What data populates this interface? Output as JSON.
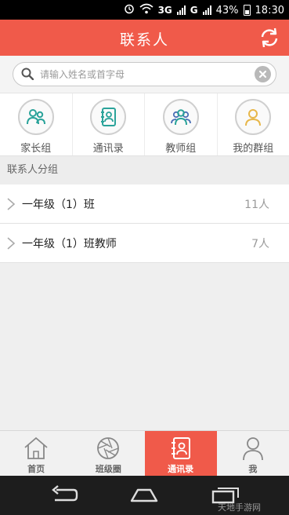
{
  "status_bar": {
    "network": "3G",
    "network2": "G",
    "battery": "43%",
    "time": "18:30"
  },
  "header": {
    "title": "联系人"
  },
  "search": {
    "placeholder": "请输入姓名或首字母"
  },
  "categories": [
    {
      "label": "家长组",
      "icon": "parents-icon"
    },
    {
      "label": "通讯录",
      "icon": "address-book-icon"
    },
    {
      "label": "教师组",
      "icon": "teachers-icon"
    },
    {
      "label": "我的群组",
      "icon": "my-group-icon"
    }
  ],
  "section": {
    "title": "联系人分组"
  },
  "groups": [
    {
      "name": "一年级（1）班",
      "count": "11人"
    },
    {
      "name": "一年级（1）班教师",
      "count": "7人"
    }
  ],
  "tabs": [
    {
      "label": "首页",
      "icon": "home-icon"
    },
    {
      "label": "班级圈",
      "icon": "aperture-icon"
    },
    {
      "label": "通讯录",
      "icon": "contacts-icon",
      "active": true
    },
    {
      "label": "我",
      "icon": "person-icon"
    }
  ],
  "watermark": "天地手游网",
  "colors": {
    "accent": "#f05a4a",
    "teal": "#2aa39a",
    "gold": "#e7b74a"
  }
}
